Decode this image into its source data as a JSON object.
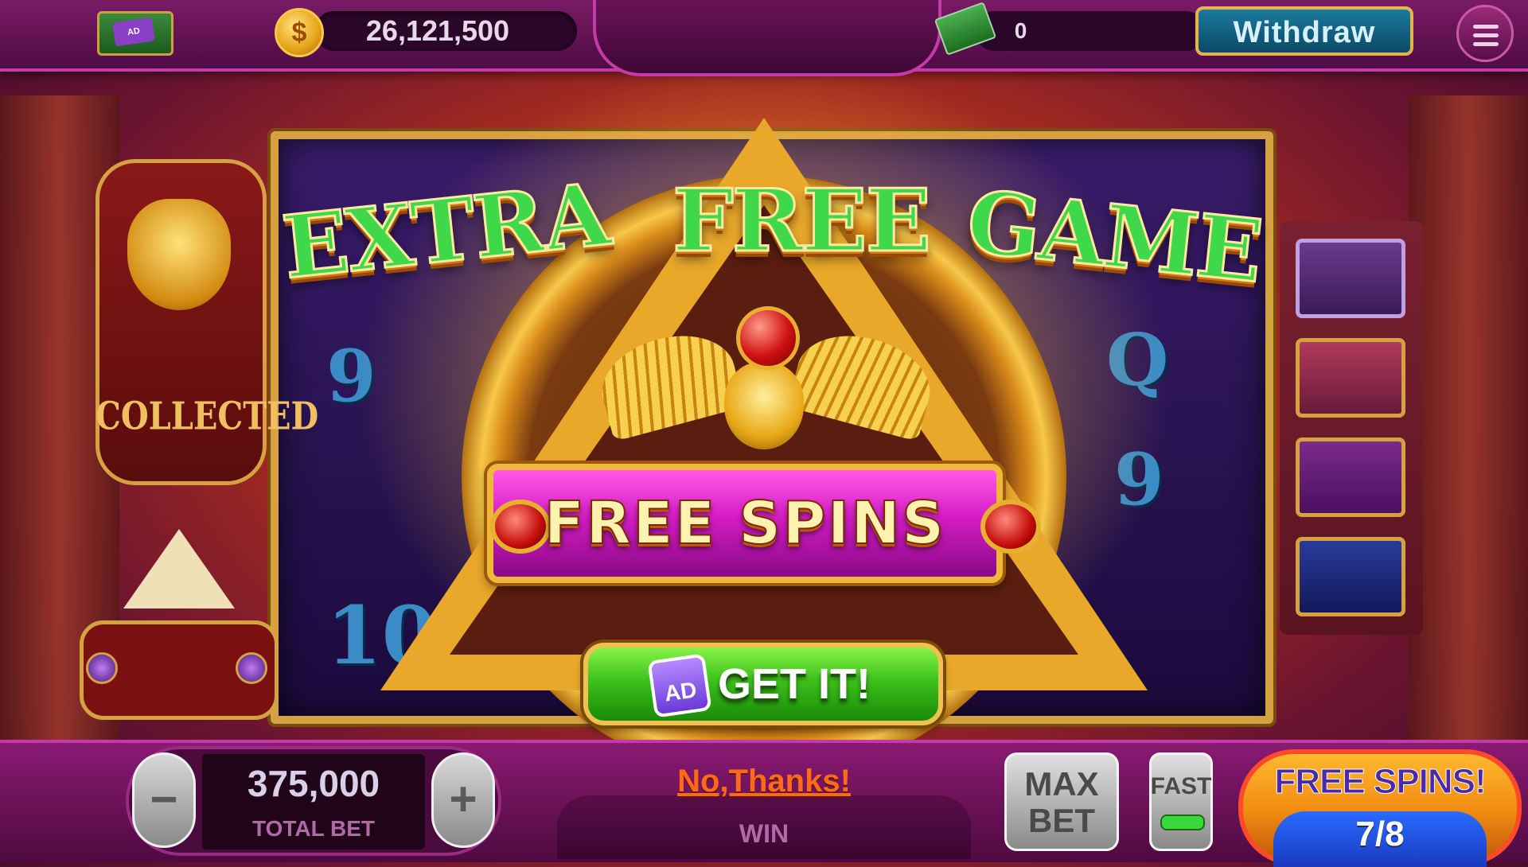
{
  "header": {
    "balance": "26,121,500",
    "cash_balance": "0",
    "withdraw_label": "Withdraw",
    "ad_label": "AD"
  },
  "reels": {
    "symbols_left": [
      "9",
      "10"
    ],
    "symbols_right": [
      "Q",
      "9"
    ]
  },
  "collector": {
    "label": "COLLECTED"
  },
  "popup": {
    "title_words": [
      "EXTRA",
      "FREE",
      "GAME"
    ],
    "banner_text": "FREE SPINS",
    "cta_label": "GET IT!",
    "cta_badge": "AD",
    "decline_label": "No,Thanks!"
  },
  "footer": {
    "total_bet_value": "375,000",
    "total_bet_label": "TOTAL BET",
    "minus_label": "−",
    "plus_label": "+",
    "win_label": "WIN",
    "max_bet_label": "MAX BET",
    "fast_label": "FAST",
    "spin_button_title": "FREE SPINS!",
    "spin_button_count": "7/8"
  },
  "colors": {
    "title_green": "#3fd84a",
    "banner_magenta": "#d41cc4",
    "cta_green": "#3cc21a",
    "gold": "#e9a82a",
    "decline_orange": "#ff6a1a"
  },
  "icons": [
    "cash-ad-icon",
    "coin-icon",
    "cash-icon",
    "menu-icon",
    "scarab-icon",
    "pyramid-icon",
    "ruby-gem-icon",
    "ad-badge-icon"
  ]
}
